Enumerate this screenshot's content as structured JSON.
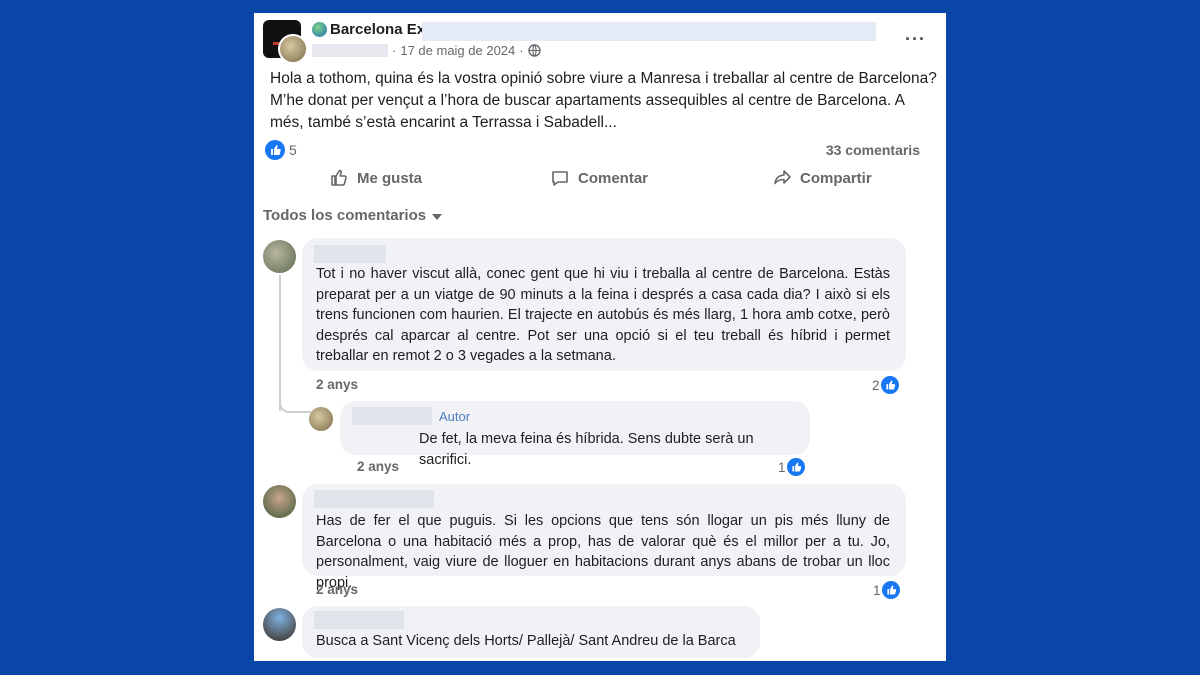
{
  "post": {
    "group_name": "Barcelona Ex",
    "date": "17 de maig de 2024",
    "separator": "·",
    "body": "Hola a tothom, quina és la vostra opinió sobre viure a Manresa i treballar al centre de Barcelona? M’he donat per vençut a l’hora de buscar apartaments assequibles al centre de Barcelona. A més, també s’està encarint a Terrassa i Sabadell...",
    "reaction_count": "5",
    "comments_count": "33 comentaris",
    "more_icon": "···"
  },
  "actions": {
    "like": "Me gusta",
    "comment": "Comentar",
    "share": "Compartir"
  },
  "comments_filter": "Todos los comentarios",
  "comments": [
    {
      "text": "Tot i no haver viscut allà, conec gent que hi viu i treballa al centre de Barcelona. Estàs preparat per a un viatge de 90 minuts a la feina i després a casa cada dia? I això si els trens funcionen com haurien. El trajecte en autobús és més llarg, 1 hora amb cotxe, però després cal aparcar al centre. Pot ser una opció si el teu treball és híbrid i permet treballar en remot 2 o 3 vegades a la setmana.",
      "time": "2 anys",
      "likes": "2"
    },
    {
      "author_badge": "Autor",
      "text": "De fet, la meva feina és híbrida. Sens dubte serà un sacrifici.",
      "time": "2 anys",
      "likes": "1"
    },
    {
      "text": "Has de fer el que puguis. Si les opcions que tens són llogar un pis més lluny de Barcelona o una habitació més a prop, has de valorar què és el millor per a tu. Jo, personalment, vaig viure de lloguer en habitacions durant anys abans de trobar un lloc propi.",
      "time": "2 anys",
      "likes": "1"
    },
    {
      "text": "Busca a Sant Vicenç dels Horts/ Pallejà/ Sant Andreu de la Barca"
    }
  ],
  "colors": {
    "background": "#0a46a8",
    "card": "#ffffff",
    "bubble": "#f0f2f5",
    "like_blue": "#1877f2",
    "secondary_text": "#65676b"
  },
  "icons": [
    "globe-icon",
    "more-icon",
    "like-icon",
    "comment-icon",
    "share-icon",
    "caret-down-icon"
  ]
}
